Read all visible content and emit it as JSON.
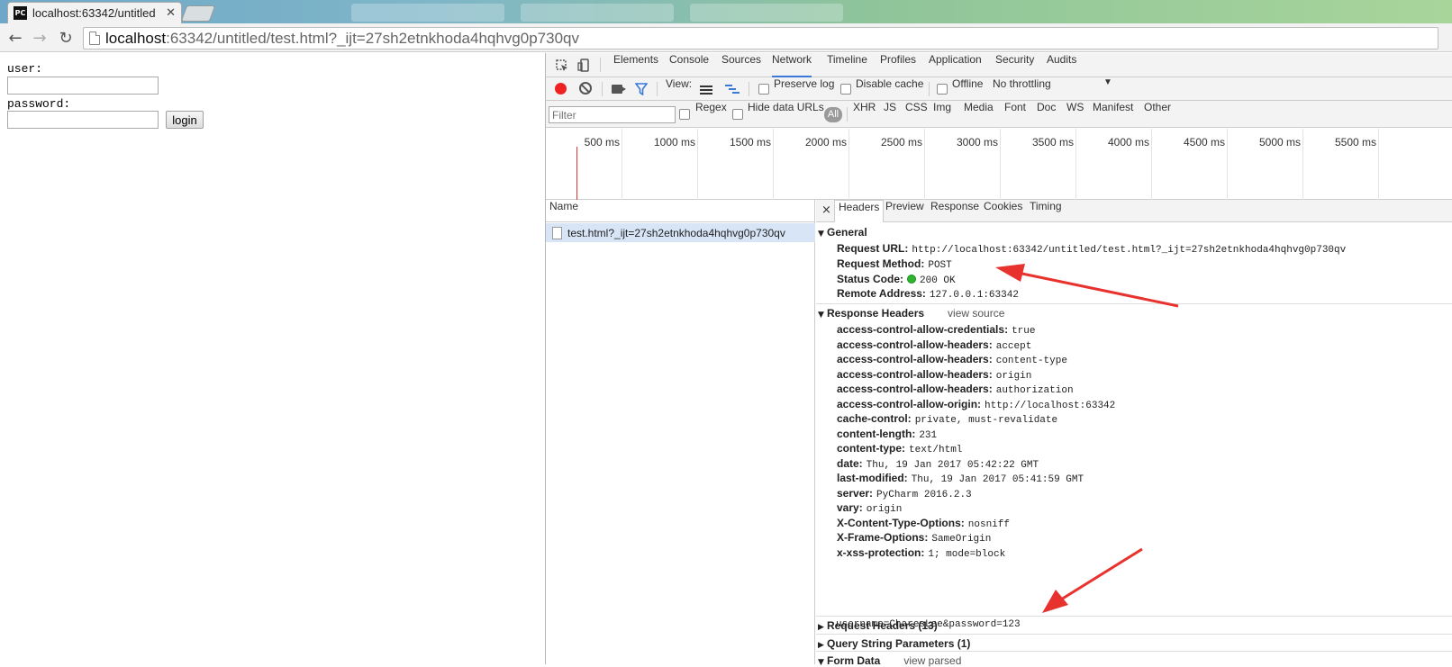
{
  "browser": {
    "tab_title": "localhost:63342/untitled",
    "tab_favicon": "PC",
    "url_host": "localhost",
    "url_rest": ":63342/untitled/test.html?_ijt=27sh2etnkhoda4hqhvg0p730qv"
  },
  "page": {
    "user_label": "user:",
    "password_label": "password:",
    "login_button": "login"
  },
  "devtools": {
    "tabs": [
      "Elements",
      "Console",
      "Sources",
      "Network",
      "Timeline",
      "Profiles",
      "Application",
      "Security",
      "Audits"
    ],
    "active_tab": "Network",
    "toolbar": {
      "view_label": "View:",
      "preserve_log": "Preserve log",
      "disable_cache": "Disable cache",
      "offline": "Offline",
      "throttling": "No throttling"
    },
    "filter": {
      "placeholder": "Filter",
      "regex": "Regex",
      "hide_data_urls": "Hide data URLs",
      "all": "All",
      "types": [
        "XHR",
        "JS",
        "CSS",
        "Img",
        "Media",
        "Font",
        "Doc",
        "WS",
        "Manifest",
        "Other"
      ]
    },
    "timeline_ticks": [
      "500 ms",
      "1000 ms",
      "1500 ms",
      "2000 ms",
      "2500 ms",
      "3000 ms",
      "3500 ms",
      "4000 ms",
      "4500 ms",
      "5000 ms",
      "5500 ms"
    ],
    "request_list": {
      "column": "Name",
      "rows": [
        "test.html?_ijt=27sh2etnkhoda4hqhvg0p730qv"
      ]
    },
    "detail": {
      "close": "×",
      "tabs": [
        "Headers",
        "Preview",
        "Response",
        "Cookies",
        "Timing"
      ],
      "general": {
        "title": "General",
        "request_url_k": "Request URL:",
        "request_url_v": "http://localhost:63342/untitled/test.html?_ijt=27sh2etnkhoda4hqhvg0p730qv",
        "method_k": "Request Method:",
        "method_v": "POST",
        "status_k": "Status Code:",
        "status_v": "200 OK",
        "remote_k": "Remote Address:",
        "remote_v": "127.0.0.1:63342"
      },
      "response_headers": {
        "title": "Response Headers",
        "view_source": "view source",
        "items": [
          {
            "k": "access-control-allow-credentials:",
            "v": "true"
          },
          {
            "k": "access-control-allow-headers:",
            "v": "accept"
          },
          {
            "k": "access-control-allow-headers:",
            "v": "content-type"
          },
          {
            "k": "access-control-allow-headers:",
            "v": "origin"
          },
          {
            "k": "access-control-allow-headers:",
            "v": "authorization"
          },
          {
            "k": "access-control-allow-origin:",
            "v": "http://localhost:63342"
          },
          {
            "k": "cache-control:",
            "v": "private, must-revalidate"
          },
          {
            "k": "content-length:",
            "v": "231"
          },
          {
            "k": "content-type:",
            "v": "text/html"
          },
          {
            "k": "date:",
            "v": "Thu, 19 Jan 2017 05:42:22 GMT"
          },
          {
            "k": "last-modified:",
            "v": "Thu, 19 Jan 2017 05:41:59 GMT"
          },
          {
            "k": "server:",
            "v": "PyCharm 2016.2.3"
          },
          {
            "k": "vary:",
            "v": "origin"
          },
          {
            "k": "X-Content-Type-Options:",
            "v": "nosniff"
          },
          {
            "k": "X-Frame-Options:",
            "v": "SameOrigin"
          },
          {
            "k": "x-xss-protection:",
            "v": "1; mode=block"
          }
        ]
      },
      "request_headers": "Request Headers (13)",
      "query_string": "Query String Parameters (1)",
      "form_data": {
        "title": "Form Data",
        "view_parsed": "view parsed",
        "value": "username=CharesLee&password=123"
      }
    }
  },
  "colors": {
    "record": "#e22222",
    "status_ok": "#2db52d",
    "arrow": "#e8322e",
    "selected_row": "#d7e5f7"
  }
}
